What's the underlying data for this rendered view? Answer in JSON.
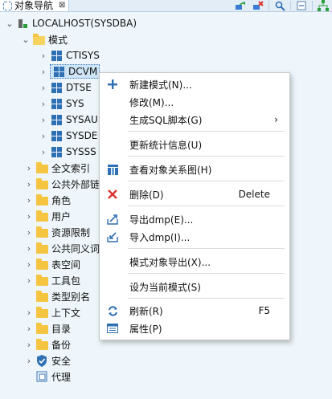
{
  "titlebar": {
    "tab_label": "对象导航",
    "close_glyph": "⊠"
  },
  "toolbar": {
    "icons": [
      "connect-icon",
      "disconnect-icon",
      "search-icon",
      "collapse-icon",
      "layout-icon"
    ]
  },
  "tree": {
    "root": "LOCALHOST(SYSDBA)",
    "schemas_folder": "模式",
    "schemas": [
      "CTISYS",
      "DCVM",
      "DTSE",
      "SYS",
      "SYSAUDITOR",
      "SYSDBA",
      "SYSSSO"
    ],
    "schemas_shown": [
      "CTISYS",
      "DCVM",
      "DTSE",
      "SYS",
      "SYSAU",
      "SYSDE",
      "SYSSS"
    ],
    "folders": [
      "全文索引",
      "公共外部链",
      "角色",
      "用户",
      "资源限制",
      "公共同义词",
      "表空间",
      "工具包",
      "类型别名",
      "上下文",
      "目录",
      "备份",
      "安全",
      "代理"
    ]
  },
  "context_menu": {
    "new_schema": "新建模式(N)...",
    "modify": "修改(M)...",
    "gen_sql": "生成SQL脚本(G)",
    "update_stats": "更新统计信息(U)",
    "view_diagram": "查看对象关系图(H)",
    "delete": "删除(D)",
    "delete_shortcut": "Delete",
    "export_dmp": "导出dmp(E)...",
    "import_dmp": "导入dmp(I)...",
    "export_schema_objects": "模式对象导出(X)...",
    "set_current": "设为当前模式(S)",
    "refresh": "刷新(R)",
    "refresh_shortcut": "F5",
    "properties": "属性(P)",
    "submenu_arrow": "›"
  },
  "colors": {
    "selection": "#cde4f7",
    "folder": "#f5c542",
    "schema_icon": "#2f6fb3"
  }
}
